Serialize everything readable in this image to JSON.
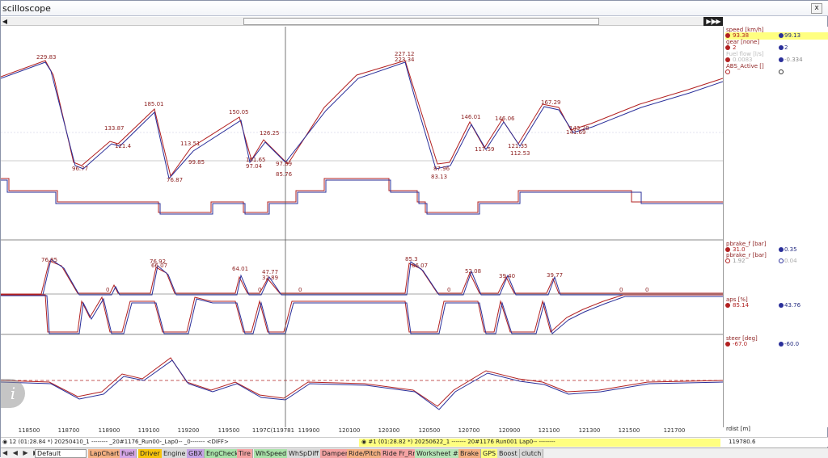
{
  "window": {
    "title": "scilloscope",
    "close_label": "x"
  },
  "scroll": {
    "left_arrow": "◀",
    "end_buttons": "▶|▶▶"
  },
  "legend": {
    "groups": [
      {
        "title": "speed [km/h]",
        "rows": [
          {
            "v1": "93.38",
            "v2": "99.13",
            "highlight": true
          },
          {
            "title_row": "gear [none]"
          },
          {
            "v1": "2",
            "v2": "2"
          },
          {
            "v1": "Fuel flow [l/s]",
            "v2": ""
          },
          {
            "v1": "0.0083",
            "v2": "-0.334"
          },
          {
            "v1": "ABS_Active []",
            "v2": ""
          }
        ]
      },
      {
        "title": "pbrake_f [bar]",
        "rows": [
          {
            "v1": "31.0",
            "v2": "0.35"
          },
          {
            "title_row": "pbrake_r [bar]"
          },
          {
            "v1": "1.92",
            "v2": "0.04"
          }
        ]
      },
      {
        "title": "aps [%]",
        "rows": [
          {
            "v1": "85.14",
            "v2": "43.76"
          }
        ]
      },
      {
        "title": "steer [deg]",
        "rows": [
          {
            "v1": "-67.0",
            "v2": "-60.0"
          }
        ]
      },
      {
        "title": "rdist [m]",
        "rows": [
          {
            "v1": "119780.6",
            "v2": ""
          }
        ]
      }
    ],
    "speed_title": "speed [km/h]",
    "speed_v1": "93.38",
    "speed_v2": "99.13",
    "gear_title": "gear [none]",
    "gear_v1": "2",
    "gear_v2": "2",
    "fuel_title": "Fuel flow [l/s]",
    "fuel_v1": "0.0083",
    "fuel_v2": "-0.334",
    "abs_title": "ABS_Active []",
    "pbf_title": "pbrake_f [bar]",
    "pbf_v1": "31.0",
    "pbf_v2": "0.35",
    "pbr_title": "pbrake_r [bar]",
    "pbr_v1": "1.92",
    "pbr_v2": "0.04",
    "aps_title": "aps [%]",
    "aps_v1": "85.14",
    "aps_v2": "43.76",
    "steer_title": "steer [deg]",
    "steer_v1": "-67.0",
    "steer_v2": "-60.0",
    "rdist_title": "rdist [m]",
    "rdist_v1": "119780.6"
  },
  "xaxis": {
    "ticks": [
      "118500",
      "118700",
      "118900",
      "119100",
      "119200",
      "119500",
      "1197C(119781",
      "119900",
      "120100",
      "120300",
      "120500",
      "120700",
      "120900",
      "121100",
      "121300",
      "121500",
      "121700"
    ]
  },
  "speed_labels": [
    "229.83",
    "133.87",
    "121.4",
    "185.01",
    "113.51",
    "99.85",
    "150.05",
    "126.25",
    "101.65",
    "97.04",
    "97.89",
    "85.76",
    "76.87",
    "96.77",
    "227.12",
    "223.34",
    "146.01",
    "117.59",
    "146.06",
    "121.35",
    "112.53",
    "167.29",
    "143.28",
    "141.69",
    "87.96",
    "83.13"
  ],
  "brake_labels": [
    "76.85",
    "76.92",
    "66.07",
    "64.01",
    "47.77",
    "32.89",
    "85.3",
    "66.07",
    "52.08",
    "39.40",
    "39.77",
    "0",
    "0",
    "0",
    "0",
    "0",
    "0"
  ],
  "status": {
    "left": "◉ 12 (01:28.84 *) 20250410_1 -------- _20#1176_Run00-_Lap0-- _0------- <DIFF>",
    "right": "◉ #1 (01:28.82 *) 20250622_1 ------- 20#1176 Run001 Lap0-- --------",
    "rdist": "119780.6"
  },
  "tabbar": {
    "navs": "◀ ◀ ▶ ▶",
    "worksheet": "Default",
    "tabs": [
      {
        "label": "LapChart",
        "color": "#f4b183"
      },
      {
        "label": "Fuel",
        "color": "#d5a6e6"
      },
      {
        "label": "Driver",
        "color": "#f7c40a"
      },
      {
        "label": "Engine",
        "color": "#d9d9d9"
      },
      {
        "label": "GBX",
        "color": "#c5a3e6"
      },
      {
        "label": "EngCheck",
        "color": "#a9e2a9"
      },
      {
        "label": "Tire",
        "color": "#f4a3a3"
      },
      {
        "label": "WhSpeed",
        "color": "#a9e2a9"
      },
      {
        "label": "WhSpDiff",
        "color": "#d9d9d9"
      },
      {
        "label": "Damper",
        "color": "#f4a3a3"
      },
      {
        "label": "Ride/Pitch",
        "color": "#f4b183"
      },
      {
        "label": "Ride Fr_Rr",
        "color": "#f4a3a3"
      },
      {
        "label": "Worksheet #1",
        "color": "#b7e4b7"
      },
      {
        "label": "Brake",
        "color": "#f4b183"
      },
      {
        "label": "GPS",
        "color": "#ffff80"
      },
      {
        "label": "Boost",
        "color": "#d9d9d9"
      },
      {
        "label": "clutch",
        "color": "#d9d9d9"
      }
    ]
  },
  "colors": {
    "trace_a": "#b22020",
    "trace_b": "#2a2f9a",
    "cursor": "#555555",
    "highlight": "#ffff80"
  }
}
